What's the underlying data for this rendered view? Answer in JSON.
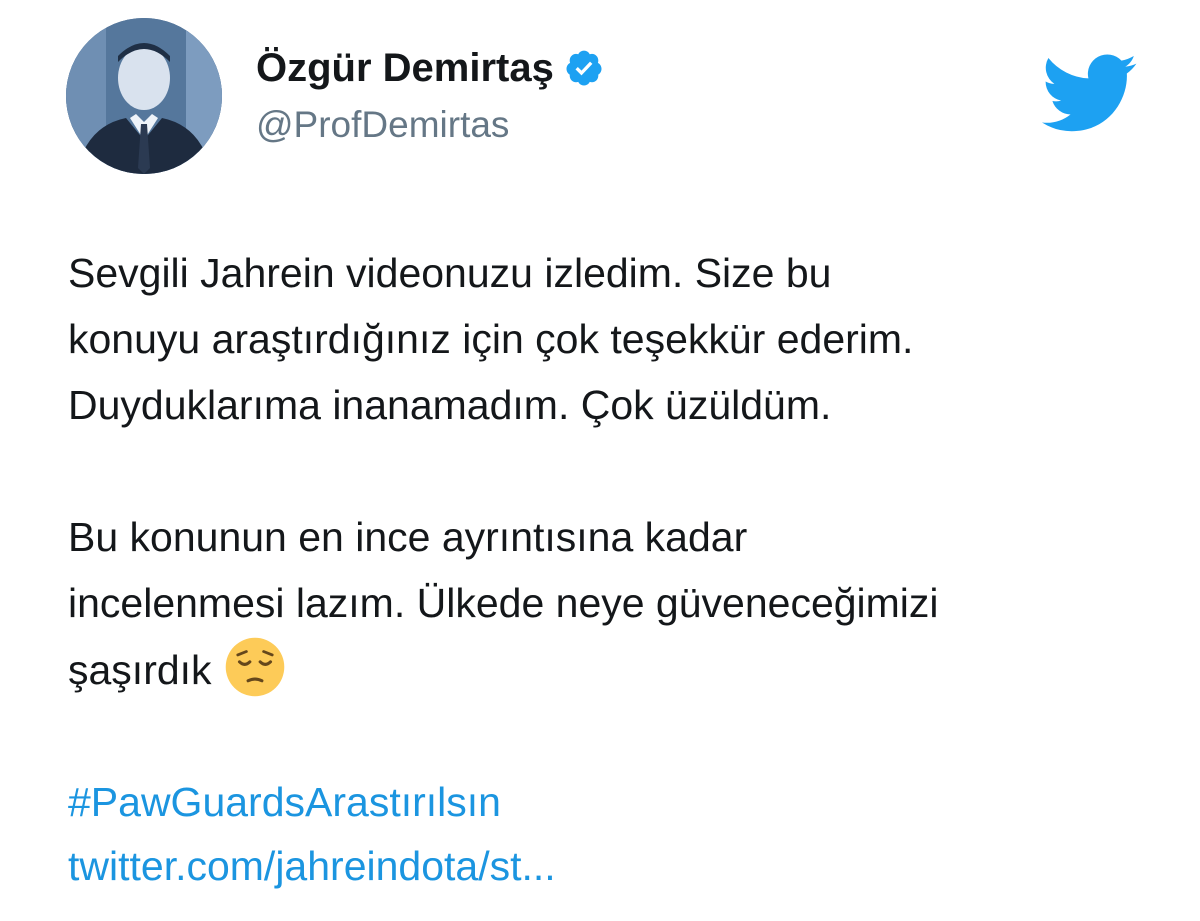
{
  "profile": {
    "display_name": "Özgür Demirtaş",
    "handle": "@ProfDemirtas",
    "verified": true
  },
  "icons": {
    "avatar": "profile-photo",
    "verified": "verified-badge-icon",
    "brand": "twitter-bird-icon",
    "emoji": "pensive-face-emoji"
  },
  "tweet": {
    "lines_para1": [
      "Sevgili Jahrein videonuzu izledim. Size bu",
      "konuyu araştırdığınız için çok teşekkür ederim.",
      "Duyduklarıma inanamadım. Çok üzüldüm."
    ],
    "lines_para2": [
      "Bu konunun en ince ayrıntısına kadar",
      "incelenmesi lazım. Ülkede neye güveneceğimizi",
      "şaşırdık"
    ],
    "hashtag": "#PawGuardsArastırılsın",
    "url": "twitter.com/jahreindota/st..."
  },
  "colors": {
    "brand_blue": "#1da1f2",
    "link_blue": "#1b95e0",
    "handle_gray": "#657786",
    "text": "#14171a"
  }
}
